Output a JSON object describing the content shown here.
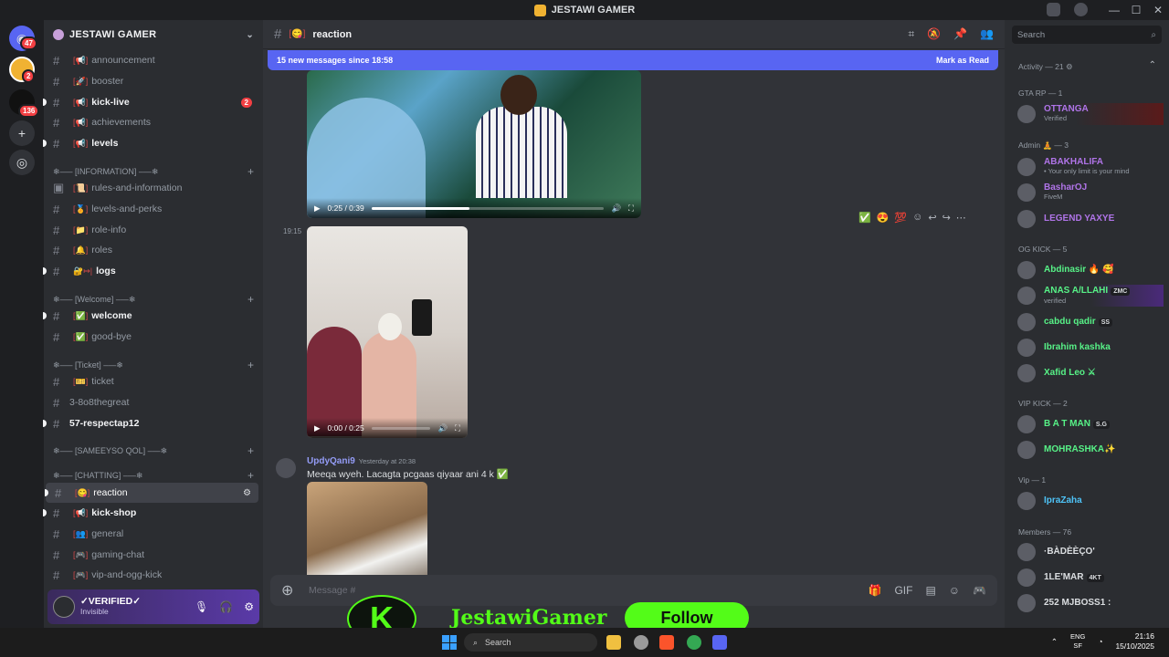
{
  "window": {
    "title": "JESTAWI GAMER"
  },
  "rail": {
    "badge1": "47",
    "badge2": "2",
    "badge3": "136"
  },
  "guild": {
    "name": "JESTAWI GAMER"
  },
  "channels": {
    "announcement": "announcement",
    "booster": "booster",
    "kick_live": "kick-live",
    "kick_live_badge": "2",
    "achievements": "achievements",
    "levels": "levels",
    "cat_information": "❄—– [INFORMATION] –—❄",
    "rules": "rules-and-information",
    "levels_perks": "levels-and-perks",
    "role_info": "role-info",
    "roles": "roles",
    "logs": "logs",
    "cat_welcome": "❄—– [Welcome] –—❄",
    "welcome": "welcome",
    "goodbye": "good-bye",
    "cat_ticket": "❄—– [Ticket] –—❄",
    "ticket": "ticket",
    "thread1": "3-8o8thegreat",
    "thread2": "57-respectap12",
    "cat_sameeyso": "❄—– [SAMEEYSO QOL] –—❄",
    "cat_chatting": "❄—– [CHATTING] –—❄",
    "reaction": "reaction",
    "kick_shop": "kick-shop",
    "general": "general",
    "gaming_chat": "gaming-chat",
    "vip_ogg_kick": "vip-and-ogg-kick"
  },
  "user": {
    "name": "✓VERIFIED✓",
    "status": "Invisible"
  },
  "chat": {
    "channel": "reaction",
    "new_messages": "15 new messages since 18:58",
    "mark_read": "Mark as Read",
    "video1_time": "0:25 / 0:39",
    "video1_progress": 0.42,
    "video2_time": "0:00 / 0:25",
    "video2_progress": 0.0,
    "time_1915": "19:15",
    "author": "UpdyQani9",
    "author_ts": "Yesterday at 20:38",
    "message": "Meeqa wyeh. Lacagta pcgaas qiyaar ani 4 k ✅",
    "composer_placeholder": "Message #"
  },
  "members": {
    "search_placeholder": "Search",
    "activity": "Activity — 21",
    "gta_rp": "GTA RP — 1",
    "m_ottanga": "OTTANGA",
    "m_ottanga_s": "Verified",
    "admin": "Admin 🧘 — 3",
    "m_abakhalifa": "ABAKHALIFA",
    "m_abakhalifa_s": "• Your only limit is your mind",
    "m_basharoj": "BasharOJ",
    "m_basharoj_s": "FiveM",
    "m_legend": "LEGEND YAXYE",
    "og_kick": "OG KICK — 5",
    "m_abdinasir": "Abdinasir 🔥 🥰",
    "m_anas": "ANAS A/LLAHI",
    "m_anas_tag": "ZMC",
    "m_anas_s": "verified",
    "m_cabdu": "cabdu qadir",
    "m_cabdu_tag": "SS",
    "m_ibrahim": "Ibrahim kashka",
    "m_xafid": "Xafid Leo ⚔",
    "vip_kick": "VIP KICK — 2",
    "m_batman": "B A T MAN",
    "m_batman_tag": "S.G",
    "m_mohrashka": "MOHRASHKA✨",
    "vip": "Vip — 1",
    "m_iprazaha": "IpraZaha",
    "members_group": "Members — 76",
    "m_badeeco": "·BÀDÈÈÇO'",
    "m_ilemar": "1LE'MAR",
    "m_ilemar_tag": "4KT",
    "m_mjboss": "252 MJBOSS1 :"
  },
  "overlay": {
    "name": "JestawiGamer",
    "follow": "Follow"
  },
  "taskbar": {
    "search": "Search",
    "lang1": "ENG",
    "lang2": "SF",
    "time": "21:16",
    "date": "15/10/2025"
  },
  "colors": {
    "accent": "#5865f2",
    "kick_green": "#53fc18",
    "mention_red": "#f23f43"
  }
}
